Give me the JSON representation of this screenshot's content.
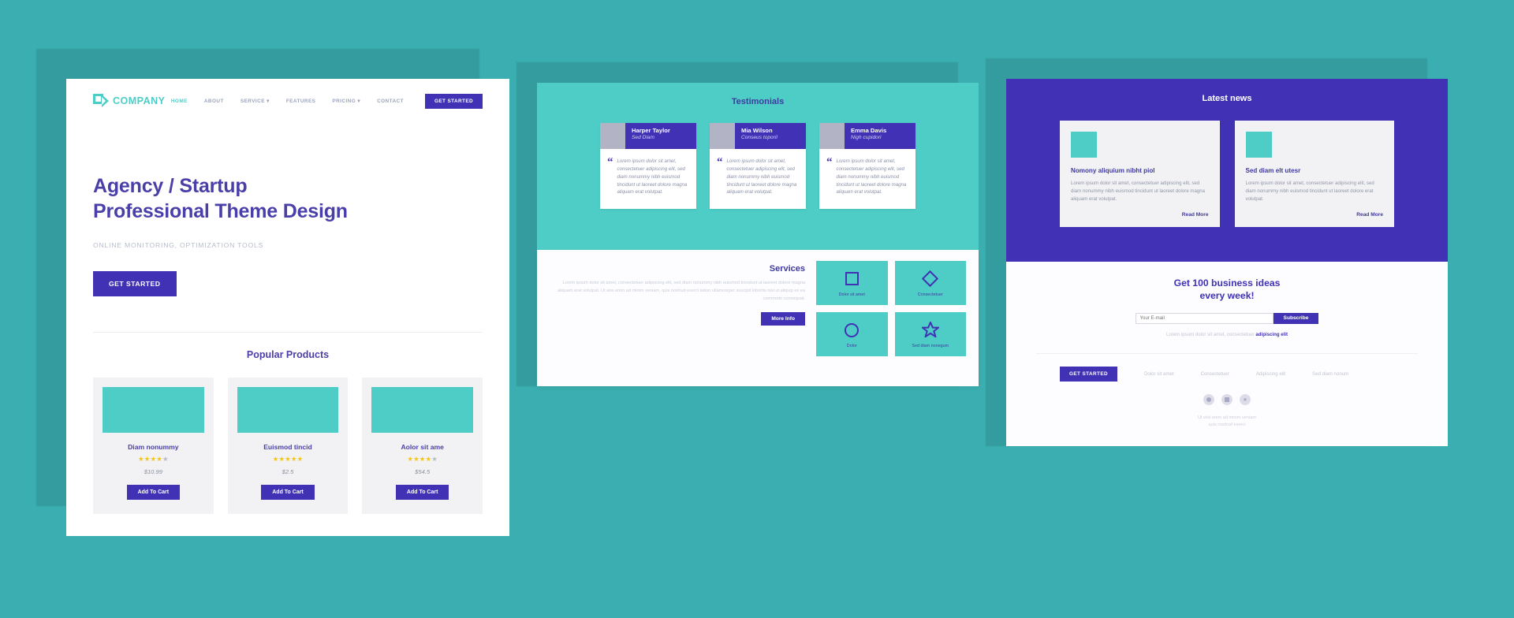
{
  "colors": {
    "page_bg": "#3aaeb0",
    "teal": "#4ecdc7",
    "purple": "#4031b5",
    "heading_purple": "#4a3fa8",
    "star_gold": "#f5c518"
  },
  "home": {
    "logo_text": "COMPANY",
    "nav": [
      {
        "label": "HOME",
        "active": true
      },
      {
        "label": "ABOUT",
        "active": false
      },
      {
        "label": "SERVICE ▾",
        "active": false
      },
      {
        "label": "FEATURES",
        "active": false
      },
      {
        "label": "PRICING ▾",
        "active": false
      },
      {
        "label": "CONTACT",
        "active": false
      }
    ],
    "nav_cta": "GET STARTED",
    "hero_line1": "Agency / Startup",
    "hero_line2": "Professional Theme Design",
    "hero_sub": "ONLINE MONITORING, OPTIMIZATION TOOLS",
    "hero_btn": "GET STARTED",
    "products_title": "Popular Products",
    "products": [
      {
        "name": "Diam nonummy",
        "price": "$10.99",
        "stars_on": 4,
        "stars_off": 1,
        "btn": "Add To Cart"
      },
      {
        "name": "Euismod tincid",
        "price": "$2.5",
        "stars_on": 5,
        "stars_off": 0,
        "btn": "Add To Cart"
      },
      {
        "name": "Aolor sit ame",
        "price": "$54.5",
        "stars_on": 4,
        "stars_off": 1,
        "btn": "Add To Cart"
      }
    ]
  },
  "testimonials": {
    "title": "Testimonials",
    "quote_glyph": "“",
    "items": [
      {
        "name": "Harper Taylor",
        "role": "Sed Diam",
        "text": "Lorem ipsum dolor sit amet, consectetuer adipiscing elit, sed diam nonummy nibh euismod tincidunt ut laoreet dolore magna aliquam erat volutpat."
      },
      {
        "name": "Mia Wilson",
        "role": "Conseus toporil",
        "text": "Lorem ipsum dolor sit amet, consectetuer adipiscing elit, sed diam nonummy nibh euismod tincidunt ut laoreet dolore magna aliquam erat volutpat."
      },
      {
        "name": "Emma Davis",
        "role": "Nigh cupidori",
        "text": "Lorem ipsum dolor sit amet, consectetuer adipiscing elit, sed diam nonummy nibh euismod tincidunt ut laoreet dolore magna aliquam erat volutpat."
      }
    ]
  },
  "services": {
    "title": "Services",
    "text": "Lorem ipsum dolor sit amet, consectetuer adipiscing elit, sed diam nonummy nibh euismod tincidunt ut laoreet dolore magna aliquam erat volutpat. Ut wisi enim ad minim veniam, quis nostrud exerci tation ullamcorper suscipit lobortis nisl ut aliquip ex ea commodo consequat.",
    "btn": "More Info",
    "tiles": [
      {
        "icon": "square-icon",
        "label": "Dolor sit amet"
      },
      {
        "icon": "diamond-icon",
        "label": "Consectetuer"
      },
      {
        "icon": "circle-icon",
        "label": "Dolor"
      },
      {
        "icon": "star-icon",
        "label": "Sed diam nonegum"
      }
    ]
  },
  "news": {
    "title": "Latest news",
    "items": [
      {
        "heading": "Nomony aliquium nibht piol",
        "text": "Lorem ipsum dolor sit amet, consectetuer adipiscing elit, sed diam nonummy nibh euismod tincidunt ut laoreet dolore magna aliquam erat volutpat.",
        "more": "Read More"
      },
      {
        "heading": "Sed diam elt utesr",
        "text": "Lorem ipsum dolor sit amet, consectetuer adipiscing elit, sed diam nonummy nibh euismod tincidunt ut laoreet dolore erat volutpat.",
        "more": "Read More"
      }
    ]
  },
  "subscribe": {
    "heading_line1": "Get 100 business ideas",
    "heading_line2": "every week!",
    "input_placeholder": "Your E-mail",
    "input_value": "",
    "btn": "Subscribe",
    "note_plain": "Lorem ipsum dolor sit amet, consectetuer ",
    "note_link": "adipiscing elit"
  },
  "footer": {
    "cta": "GET STARTED",
    "links": [
      "Dolor sit amet",
      "Consectetuer",
      "Adipiscing elit",
      "Sed diam nonum"
    ],
    "socials": [
      "circle-icon",
      "square-icon",
      "star-icon"
    ],
    "copy_line1": "Ut wisi enim ad minim veniam",
    "copy_line2": "quis nostrud exerci"
  }
}
